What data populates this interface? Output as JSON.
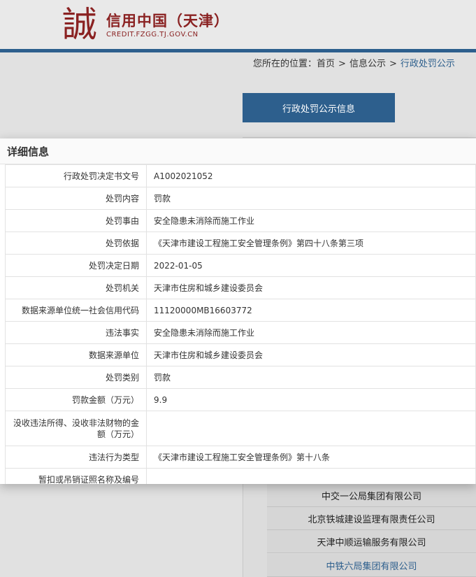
{
  "site": {
    "logo_char": "誠",
    "title": "信用中国（天津）",
    "domain": "CREDIT.FZGG.TJ.GOV.CN"
  },
  "breadcrumb": {
    "prefix": "您所在的位置：",
    "items": [
      "首页",
      "信息公示",
      "行政处罚公示"
    ],
    "separator": ">"
  },
  "tab": {
    "label": "行政处罚公示信息"
  },
  "modal": {
    "title": "详细信息",
    "rows": [
      {
        "label": "行政处罚决定书文号",
        "value": "A1002021052"
      },
      {
        "label": "处罚内容",
        "value": "罚款"
      },
      {
        "label": "处罚事由",
        "value": "安全隐患未消除而施工作业"
      },
      {
        "label": "处罚依据",
        "value": "《天津市建设工程施工安全管理条例》第四十八条第三项"
      },
      {
        "label": "处罚决定日期",
        "value": "2022-01-05"
      },
      {
        "label": "处罚机关",
        "value": "天津市住房和城乡建设委员会"
      },
      {
        "label": "数据来源单位统一社会信用代码",
        "value": "11120000MB16603772"
      },
      {
        "label": "违法事实",
        "value": "安全隐患未消除而施工作业"
      },
      {
        "label": "数据来源单位",
        "value": "天津市住房和城乡建设委员会"
      },
      {
        "label": "处罚类别",
        "value": "罚款"
      },
      {
        "label": "罚款金额（万元）",
        "value": "9.9"
      },
      {
        "label": "没收违法所得、没收非法财物的金额（万元）",
        "value": ""
      },
      {
        "label": "违法行为类型",
        "value": "《天津市建设工程施工安全管理条例》第十八条"
      },
      {
        "label": "暂扣或吊销证照名称及编号",
        "value": ""
      }
    ]
  },
  "companies": [
    "中交一公局集团有限公司",
    "北京铁城建设监理有限责任公司",
    "天津中顺运输服务有限公司",
    "中铁六局集团有限公司"
  ],
  "colors": {
    "brand_red": "#8a2222",
    "accent_blue": "#2d5f8d"
  }
}
